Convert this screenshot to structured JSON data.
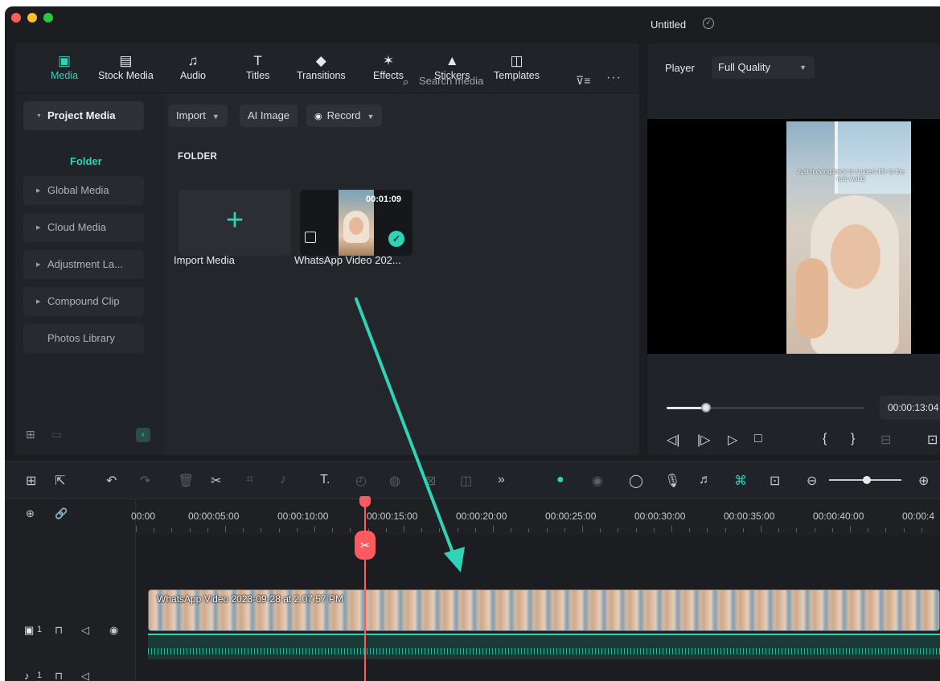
{
  "window": {
    "title": "Untitled"
  },
  "toolbar": {
    "tabs": [
      {
        "label": "Media",
        "icon": "media-icon",
        "active": true
      },
      {
        "label": "Stock Media",
        "icon": "stock-media-icon"
      },
      {
        "label": "Audio",
        "icon": "audio-icon"
      },
      {
        "label": "Titles",
        "icon": "titles-icon"
      },
      {
        "label": "Transitions",
        "icon": "transitions-icon"
      },
      {
        "label": "Effects",
        "icon": "effects-icon"
      },
      {
        "label": "Stickers",
        "icon": "stickers-icon"
      },
      {
        "label": "Templates",
        "icon": "templates-icon"
      }
    ]
  },
  "sidebar": {
    "project_media": "Project Media",
    "folder": "Folder",
    "items": [
      "Global Media",
      "Cloud Media",
      "Adjustment La...",
      "Compound Clip",
      "Photos Library"
    ]
  },
  "media": {
    "import_label": "Import",
    "ai_image_label": "AI Image",
    "record_label": "Record",
    "search_placeholder": "Search media",
    "folder_header": "FOLDER",
    "tiles": {
      "import_media": "Import Media",
      "video_name": "WhatsApp Video 202...",
      "video_duration": "00:01:09"
    }
  },
  "player": {
    "label": "Player",
    "quality": "Full Quality",
    "timecode": "00:00:13:04",
    "progress": 0.2,
    "caption": "Just moving back to student life to the real world"
  },
  "timeline": {
    "ruler_labels": [
      "00:00",
      "00:00:05:00",
      "00:00:10:00",
      "00:00:15:00",
      "00:00:20:00",
      "00:00:25:00",
      "00:00:30:00",
      "00:00:35:00",
      "00:00:40:00",
      "00:00:4"
    ],
    "clip_title": "WhatsApp Video 2023-09-28 at 2.07.57 PM",
    "video_track_label": "1",
    "audio_track_label": "1"
  },
  "colors": {
    "accent": "#2fd3b6",
    "playhead": "#ff5a5f",
    "panel": "#23262b"
  }
}
